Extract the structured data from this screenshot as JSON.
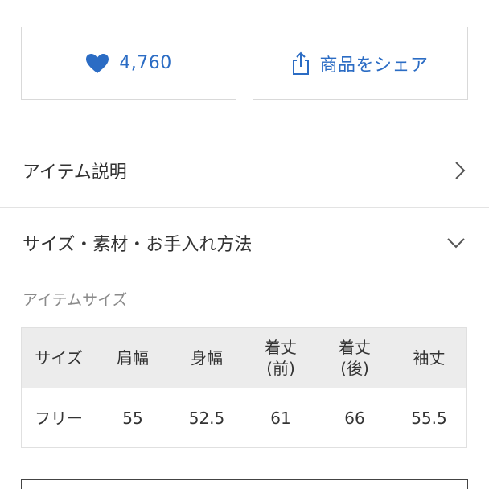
{
  "like_button": {
    "count": "4,760",
    "icon": "heart-icon"
  },
  "share_button": {
    "label": "商品をシェア",
    "icon": "share-icon"
  },
  "item_description": {
    "title": "アイテム説明",
    "icon": "chevron-right-icon"
  },
  "size_material": {
    "title": "サイズ・素材・お手入れ方法",
    "icon": "chevron-down-icon"
  },
  "size_section": {
    "subtitle": "アイテムサイズ",
    "headers": [
      {
        "line1": "サイズ",
        "line2": ""
      },
      {
        "line1": "肩幅",
        "line2": ""
      },
      {
        "line1": "身幅",
        "line2": ""
      },
      {
        "line1": "着丈",
        "line2": "(前)"
      },
      {
        "line1": "着丈",
        "line2": "(後)"
      },
      {
        "line1": "袖丈",
        "line2": ""
      }
    ],
    "rows": [
      [
        "フリー",
        "55",
        "52.5",
        "61",
        "66",
        "55.5"
      ]
    ]
  },
  "colors": {
    "accent": "#2b6cc4",
    "header_bg": "#ececec",
    "border": "#d9d9d9"
  }
}
